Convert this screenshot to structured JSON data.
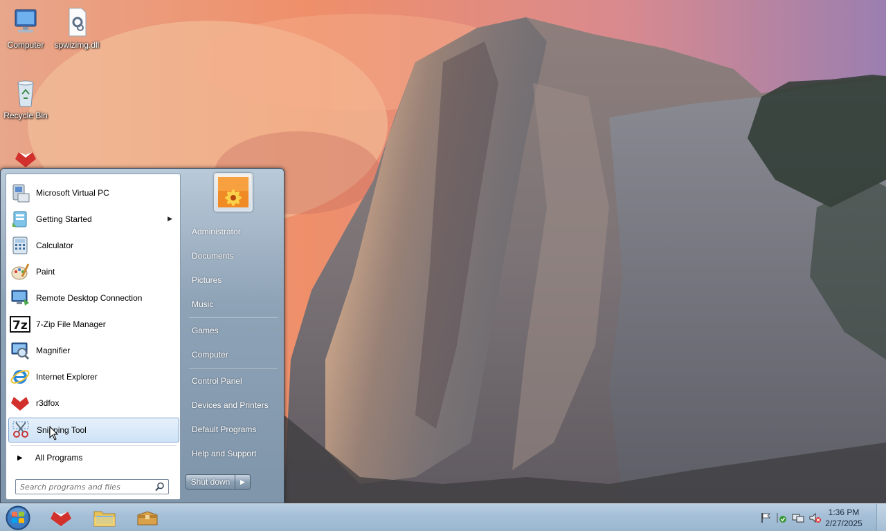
{
  "desktop": {
    "icons": [
      {
        "label": "Computer",
        "icon": "computer-icon"
      },
      {
        "label": "spwizimg.dll",
        "icon": "dll-file-icon"
      },
      {
        "label": "Recycle Bin",
        "icon": "recycle-bin-icon"
      },
      {
        "label": "",
        "icon": "r3dfox-icon"
      }
    ]
  },
  "start_menu": {
    "programs": [
      {
        "label": "Microsoft Virtual PC",
        "icon": "virtual-pc-icon"
      },
      {
        "label": "Getting Started",
        "icon": "getting-started-icon",
        "submenu": true
      },
      {
        "label": "Calculator",
        "icon": "calculator-icon"
      },
      {
        "label": "Paint",
        "icon": "paint-icon"
      },
      {
        "label": "Remote Desktop Connection",
        "icon": "remote-desktop-icon"
      },
      {
        "label": "7-Zip File Manager",
        "icon": "7zip-icon"
      },
      {
        "label": "Magnifier",
        "icon": "magnifier-icon"
      },
      {
        "label": "Internet Explorer",
        "icon": "internet-explorer-icon"
      },
      {
        "label": "r3dfox",
        "icon": "r3dfox-icon"
      },
      {
        "label": "Snipping Tool",
        "icon": "snipping-tool-icon",
        "selected": true
      }
    ],
    "all_programs": "All Programs",
    "search": {
      "placeholder": "Search programs and files"
    },
    "places": [
      "Administrator",
      "Documents",
      "Pictures",
      "Music",
      "Games",
      "Computer",
      "Control Panel",
      "Devices and Printers",
      "Default Programs",
      "Help and Support"
    ],
    "shutdown_label": "Shut down"
  },
  "taskbar": {
    "pinned": [
      "r3dfox-icon",
      "windows-explorer-icon",
      "package-icon"
    ],
    "tray_icons": [
      "action-center-flag-icon",
      "security-shield-icon",
      "network-icon",
      "volume-muted-icon"
    ],
    "clock": {
      "time": "1:36 PM",
      "date": "2/27/2025"
    }
  },
  "colors": {
    "selection_border": "#7da2ce",
    "taskbar": "#a6c0d8",
    "start_menu_right": "#8fa3b7"
  }
}
